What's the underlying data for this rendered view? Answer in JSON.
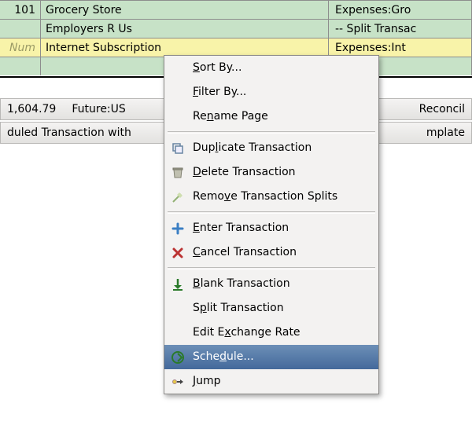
{
  "ledger": {
    "rows": [
      {
        "id": "101",
        "desc": "Grocery Store",
        "acct": "Expenses:Gro",
        "cls": "green"
      },
      {
        "id": "",
        "desc": "Employers R Us",
        "acct": "-- Split Transac",
        "cls": "green"
      },
      {
        "id": "Num",
        "desc": "Internet Subscription",
        "acct": "Expenses:Int",
        "cls": "yellow"
      },
      {
        "id": "",
        "desc": "",
        "acct": "",
        "cls": "green"
      }
    ]
  },
  "bar1": {
    "left": "1,604.79",
    "mid": "Future:US",
    "right": "Reconcil"
  },
  "bar2": {
    "left": "duled Transaction with",
    "right": "mplate"
  },
  "menu": {
    "items": [
      {
        "pre": "",
        "u": "S",
        "post": "ort By..."
      },
      {
        "pre": "",
        "u": "F",
        "post": "ilter By..."
      },
      {
        "pre": "Re",
        "u": "n",
        "post": "ame Page"
      },
      {
        "sep": true
      },
      {
        "icon": "dup",
        "pre": "Dup",
        "u": "l",
        "post": "icate Transaction"
      },
      {
        "icon": "trash",
        "pre": "",
        "u": "D",
        "post": "elete Transaction"
      },
      {
        "icon": "broom",
        "pre": "Remo",
        "u": "v",
        "post": "e Transaction Splits"
      },
      {
        "sep": true
      },
      {
        "icon": "plus",
        "pre": "",
        "u": "E",
        "post": "nter Transaction"
      },
      {
        "icon": "x",
        "pre": "",
        "u": "C",
        "post": "ancel Transaction"
      },
      {
        "sep": true
      },
      {
        "icon": "down",
        "pre": "",
        "u": "B",
        "post": "lank Transaction"
      },
      {
        "icon": "",
        "pre": "S",
        "u": "p",
        "post": "lit Transaction"
      },
      {
        "icon": "",
        "pre": "Edit E",
        "u": "x",
        "post": "change Rate"
      },
      {
        "icon": "sched",
        "pre": "Sche",
        "u": "d",
        "post": "ule...",
        "hi": true
      },
      {
        "icon": "jump",
        "pre": "",
        "u": "J",
        "post": "ump"
      }
    ]
  }
}
